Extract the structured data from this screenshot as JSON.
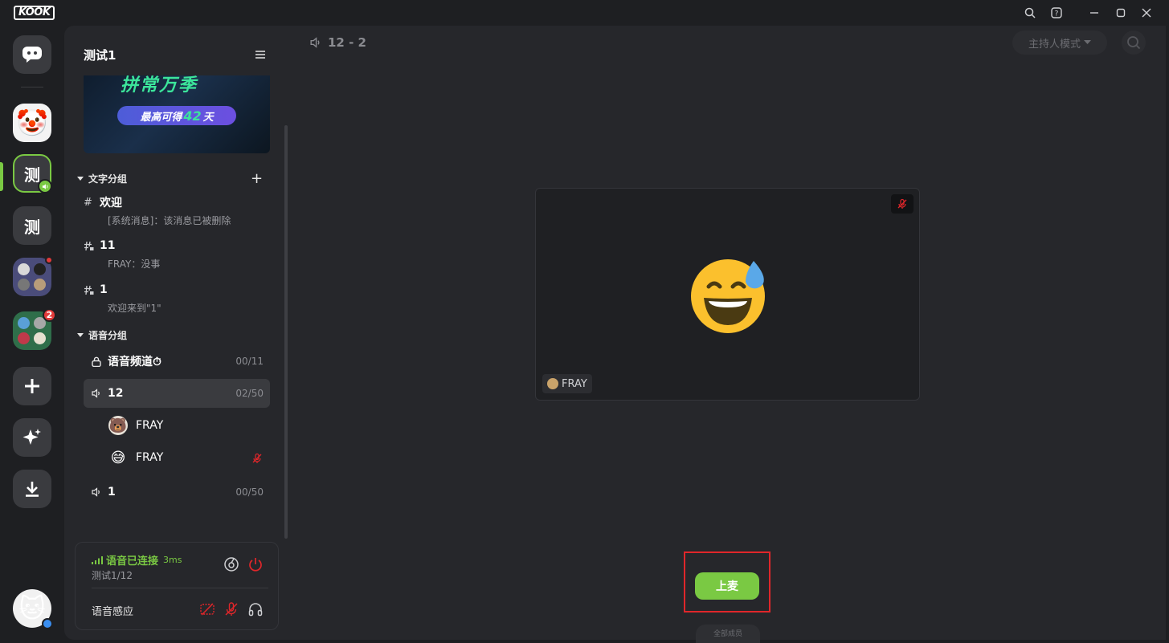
{
  "app": {
    "logo": "KOOK"
  },
  "rail": {
    "servers": [
      {
        "id": "home",
        "icon": "chat-bubble-icon"
      },
      {
        "id": "clown",
        "icon": "clown-face-icon",
        "emoji": "🤡"
      },
      {
        "id": "test-active",
        "label": "测"
      },
      {
        "id": "test-2",
        "label": "测"
      },
      {
        "id": "group-1",
        "icon": "server-grid-icon"
      },
      {
        "id": "group-2",
        "icon": "server-grid-icon",
        "badge": "2"
      },
      {
        "id": "add",
        "icon": "plus-icon"
      },
      {
        "id": "discover",
        "icon": "sparkle-icon"
      },
      {
        "id": "download",
        "icon": "download-icon"
      }
    ],
    "user_avatar": "🐱"
  },
  "panel": {
    "title": "测试1",
    "banner": {
      "headline": "拼常万季",
      "pill_prefix": "最高可得",
      "pill_number": "42",
      "pill_suffix": "天"
    },
    "text_group": {
      "label": "文字分组"
    },
    "text_channels": [
      {
        "name": "欢迎",
        "icon": "hash-icon",
        "sub": "[系统消息]：该消息已被删除"
      },
      {
        "name": "11",
        "icon": "hash-lock-icon",
        "sub": "FRAY：没事"
      },
      {
        "name": "1",
        "icon": "hash-lock-icon",
        "sub": "欢迎来到\"1\""
      }
    ],
    "voice_group": {
      "label": "语音分组"
    },
    "voice_channels": [
      {
        "name": "语音频道⏱",
        "count": "00/11",
        "icon": "lock-icon"
      },
      {
        "name": "12",
        "count": "02/50",
        "icon": "speaker-icon"
      },
      {
        "name": "1",
        "count": "00/50",
        "icon": "speaker-icon"
      }
    ],
    "members": [
      {
        "name": "FRAY",
        "avatar": "🐻"
      },
      {
        "name": "FRAY",
        "avatar": "😅",
        "muted": true
      }
    ]
  },
  "voice_card": {
    "status": "语音已连接",
    "latency": "3ms",
    "location": "测试1/12",
    "sensing_label": "语音感应"
  },
  "main": {
    "channel_title": "12 - 2",
    "host_mode": "主持人模式",
    "tile": {
      "name": "FRAY",
      "emoji": "😅"
    },
    "up_mic": "上麦",
    "peek_label": "全部成员"
  },
  "colors": {
    "accent": "#7ac943",
    "danger": "#e0262a",
    "bg": "#1e1f22",
    "panel": "#26272b"
  }
}
